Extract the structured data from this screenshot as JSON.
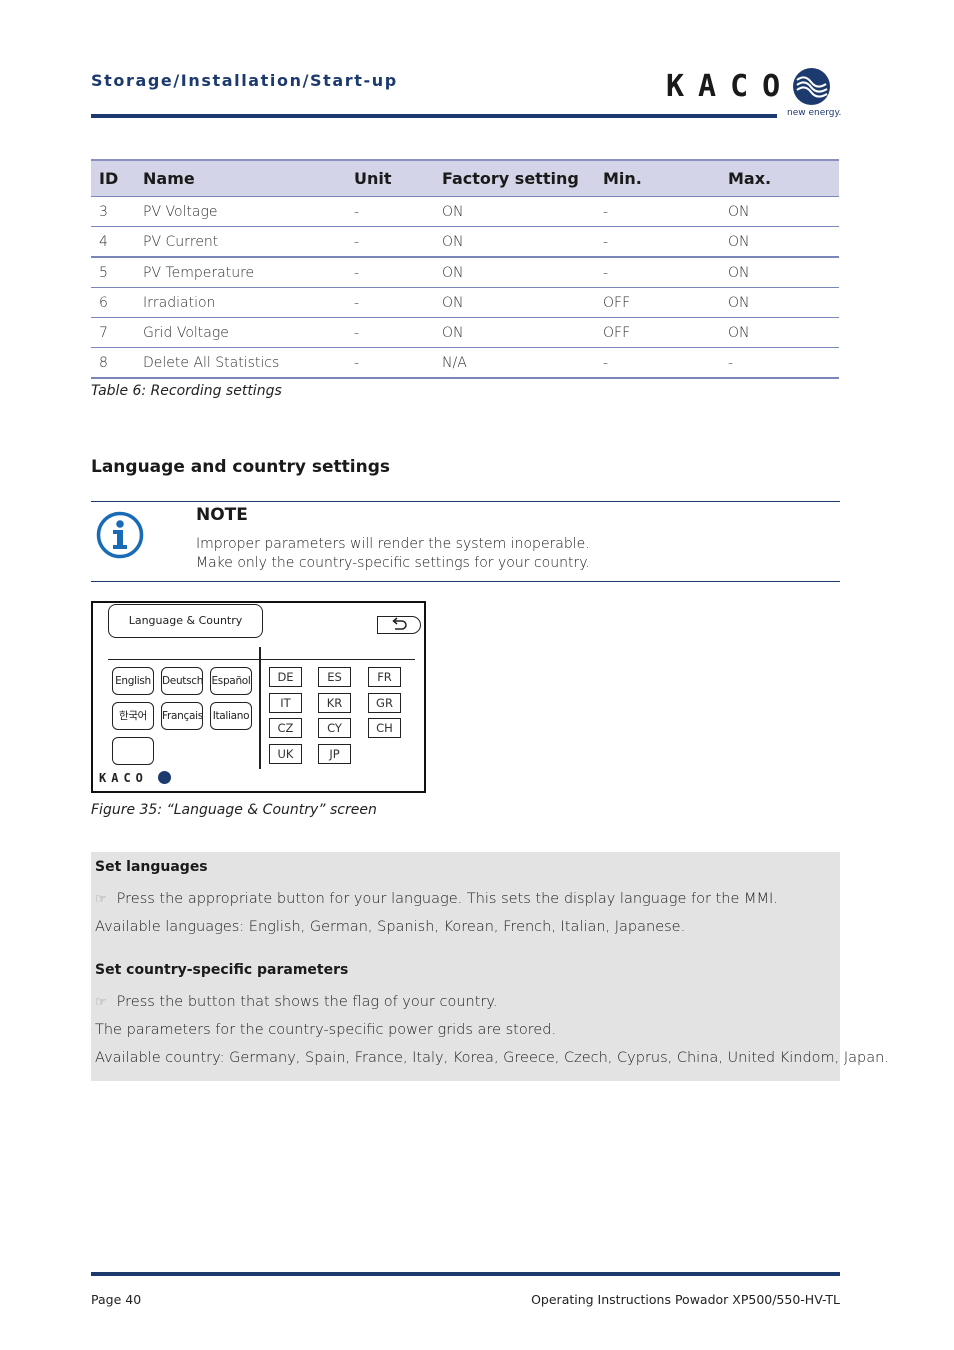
{
  "header": {
    "section_title": "Storage/Installation/Start-up",
    "logo": {
      "wordmark": "KACO",
      "tagline": "new energy.",
      "icon": "kaco-wave-circle-icon"
    }
  },
  "colors": {
    "brand": "#1d3a6e",
    "table_header_bg": "#d3d4e8",
    "infobox_bg": "#e3e3e3",
    "note_icon": "#1a6bb5"
  },
  "recording_table": {
    "columns": [
      "ID",
      "Name",
      "Unit",
      "Factory setting",
      "Min.",
      "Max."
    ],
    "rows": [
      [
        "3",
        "PV Voltage",
        "-",
        "ON",
        "-",
        "ON"
      ],
      [
        "4",
        "PV Current",
        "-",
        "ON",
        "-",
        "ON"
      ],
      [
        "5",
        "PV Temperature",
        "-",
        "ON",
        "-",
        "ON"
      ],
      [
        "6",
        "Irradiation",
        "-",
        "ON",
        "OFF",
        "ON"
      ],
      [
        "7",
        "Grid Voltage",
        "-",
        "ON",
        "OFF",
        "ON"
      ],
      [
        "8",
        "Delete All Statistics",
        "-",
        "N/A",
        "-",
        "-"
      ]
    ],
    "caption": "Table 6:  Recording settings"
  },
  "language_section": {
    "heading": "Language and country settings",
    "note": {
      "icon": "info-icon",
      "title": "NOTE",
      "lines": [
        "Improper parameters will render the system inoperable.",
        "Make only the country-specific settings for your country."
      ]
    }
  },
  "screen": {
    "title": "Language & Country",
    "back_icon": "return-arrow-icon",
    "languages": [
      "English",
      "Deutsch",
      "Español",
      "한국어",
      "Français",
      "Italiano",
      ""
    ],
    "countries": [
      "DE",
      "ES",
      "FR",
      "IT",
      "KR",
      "GR",
      "CZ",
      "CY",
      "CH",
      "UK",
      "JP"
    ],
    "logo": "KACO",
    "caption": "Figure 35:  “Language & Country” screen"
  },
  "infobox": {
    "languages_heading": "Set languages",
    "languages_step": "Press the appropriate button for your language. This sets the display language for the MMI.",
    "languages_available": "Available languages: English, German, Spanish, Korean, French, Italian, Japanese.",
    "country_heading": "Set country-specific parameters",
    "country_step": "Press the button that shows the flag of your country.",
    "country_stored": "The parameters for the country-specific power grids are stored.",
    "country_available": "Available country: Germany, Spain, France, Italy, Korea, Greece, Czech, Cyprus, China, United Kindom, Japan.",
    "step_icon": "pointing-hand-icon"
  },
  "footer": {
    "page": "Page 40",
    "doc_title": "Operating Instructions Powador XP500/550-HV-TL"
  }
}
